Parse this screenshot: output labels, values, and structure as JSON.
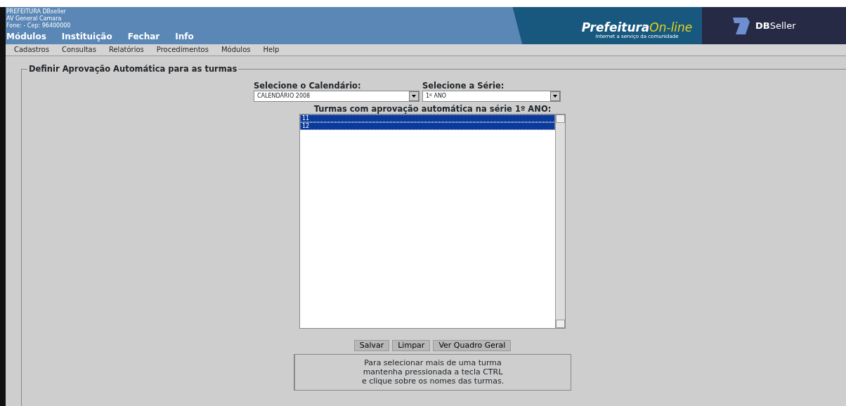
{
  "header": {
    "lines": [
      "PREFEITURA DBseller",
      "AV General Camara",
      "Fone:  - Cep: 96400000"
    ],
    "top_menu": [
      "Módulos",
      "Instituição",
      "Fechar",
      "Info"
    ],
    "banner": {
      "title_main": "Prefeitura",
      "title_accent": "On-line",
      "subtitle": "Internet a serviço da comunidade",
      "brand_bold": "DB",
      "brand_rest": "Seller"
    }
  },
  "menu": [
    "Cadastros",
    "Consultas",
    "Relatórios",
    "Procedimentos",
    "Módulos",
    "Help"
  ],
  "form": {
    "legend": "Definir Aprovação Automática para as turmas",
    "calendar": {
      "label": "Selecione o Calendário:",
      "value": "CALENDÁRIO 2008"
    },
    "series": {
      "label": "Selecione a Série:",
      "value": "1º ANO"
    },
    "list_title": "Turmas com aprovação automática na série 1º ANO:",
    "turmas": [
      {
        "label": "11",
        "selected": true
      },
      {
        "label": "12",
        "selected": true
      }
    ],
    "buttons": [
      "Salvar",
      "Limpar",
      "Ver Quadro Geral"
    ],
    "hint": [
      "Para selecionar mais de uma turma",
      "mantenha pressionada a tecla CTRL",
      "e clique sobre os nomes das turmas."
    ]
  }
}
